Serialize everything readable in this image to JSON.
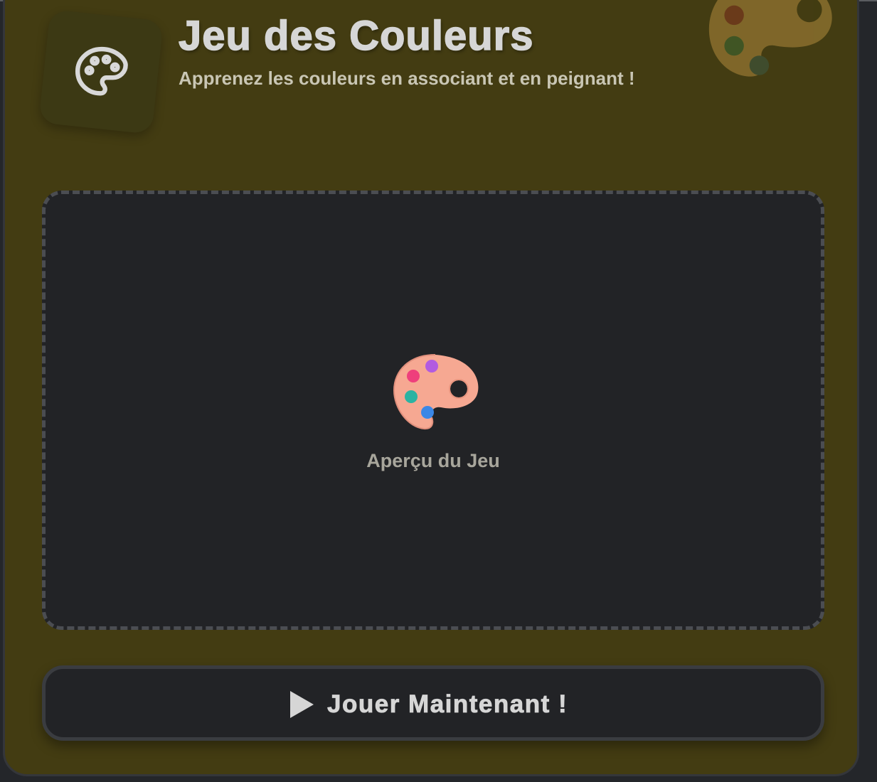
{
  "header": {
    "title": "Jeu des Couleurs",
    "subtitle": "Apprenez les couleurs en associant et en peignant !"
  },
  "preview": {
    "label": "Aperçu du Jeu"
  },
  "play_button": {
    "label": "Jouer Maintenant !"
  },
  "icons": {
    "header_icon": "palette-outline-icon",
    "decorative_icon": "palette-icon",
    "preview_icon": "palette-emoji-icon",
    "button_icon": "play-icon"
  },
  "colors": {
    "card_background": "#433c12",
    "page_background": "#24262a",
    "preview_background": "#222326",
    "text": "#d6d6d6"
  }
}
